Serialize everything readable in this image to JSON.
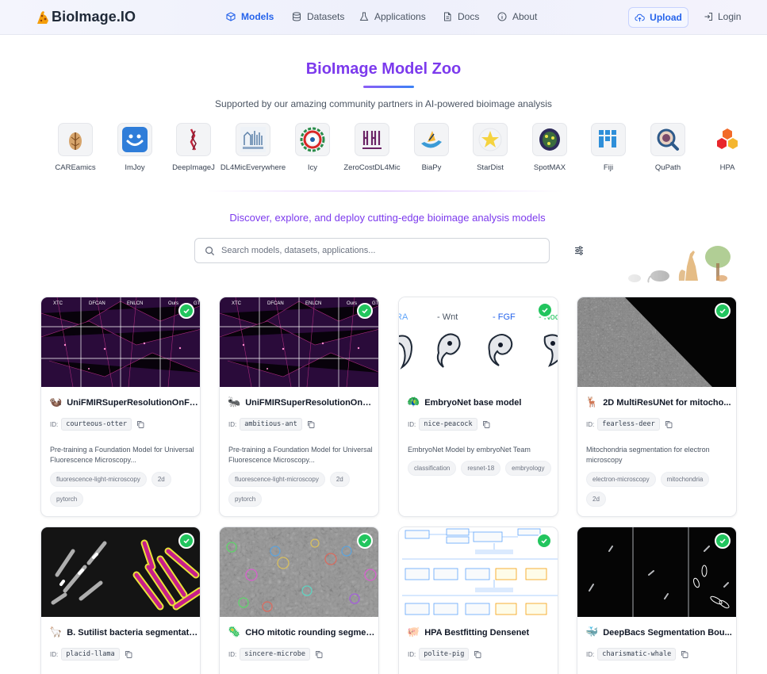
{
  "nav": {
    "logo": "BioImage.IO",
    "items": [
      {
        "label": "Models",
        "icon": "cube-icon",
        "active": true
      },
      {
        "label": "Datasets",
        "icon": "database-icon"
      },
      {
        "label": "Applications",
        "icon": "flask-icon"
      },
      {
        "label": "Docs",
        "icon": "document-icon"
      },
      {
        "label": "About",
        "icon": "info-icon"
      }
    ],
    "upload": "Upload",
    "login": "Login"
  },
  "hero": {
    "title": "BioImage Model Zoo",
    "subtitle": "Supported by our amazing community partners in AI-powered bioimage analysis"
  },
  "partners": [
    "CAREamics",
    "ImJoy",
    "DeepImageJ",
    "DL4MicEverywhere",
    "Icy",
    "ZeroCostDL4Mic",
    "BiaPy",
    "StarDist",
    "SpotMAX",
    "Fiji",
    "QuPath",
    "HPA"
  ],
  "discover": "Discover, explore, and deploy cutting-edge bioimage analysis models",
  "search": {
    "placeholder": "Search models, datasets, applications..."
  },
  "id_label": "ID:",
  "cards": [
    {
      "emoji": "🦦",
      "title": "UniFMIRSuperResolutionOnFa...",
      "id": "courteous-otter",
      "desc": "Pre-training a Foundation Model for Universal Fluorescence Microscopy...",
      "tags": [
        "fluorescence-light-microscopy",
        "2d",
        "pytorch"
      ],
      "thumb_labels": [
        "XTC",
        "DFCAN",
        "ENLCN",
        "Ours",
        "GT"
      ]
    },
    {
      "emoji": "🐜",
      "title": "UniFMIRSuperResolutionOnMi...",
      "id": "ambitious-ant",
      "desc": "Pre-training a Foundation Model for Universal Fluorescence Microscopy...",
      "tags": [
        "fluorescence-light-microscopy",
        "2d",
        "pytorch"
      ],
      "thumb_labels": [
        "XTC",
        "DFCAN",
        "ENLCN",
        "Ours",
        "GT"
      ]
    },
    {
      "emoji": "🦚",
      "title": "EmbryoNet base model",
      "id": "nice-peacock",
      "desc": "EmbryoNet Model by embryoNet Team",
      "tags": [
        "classification",
        "resnet-18",
        "embryology"
      ],
      "thumb_labels": [
        "RA",
        "- Wnt",
        "- FGF",
        "- Noc"
      ]
    },
    {
      "emoji": "🦌",
      "title": "2D MultiResUNet for mitocho...",
      "id": "fearless-deer",
      "desc": "Mitochondria segmentation for electron microscopy",
      "tags": [
        "electron-microscopy",
        "mitochondria",
        "2d"
      ]
    },
    {
      "emoji": "🦙",
      "title": "B. Sutilist bacteria segmentati...",
      "id": "placid-llama"
    },
    {
      "emoji": "🦠",
      "title": "CHO mitotic rounding segmen...",
      "id": "sincere-microbe"
    },
    {
      "emoji": "🐖",
      "title": "HPA Bestfitting Densenet",
      "id": "polite-pig"
    },
    {
      "emoji": "🐳",
      "title": "DeepBacs Segmentation Bou...",
      "id": "charismatic-whale"
    }
  ]
}
